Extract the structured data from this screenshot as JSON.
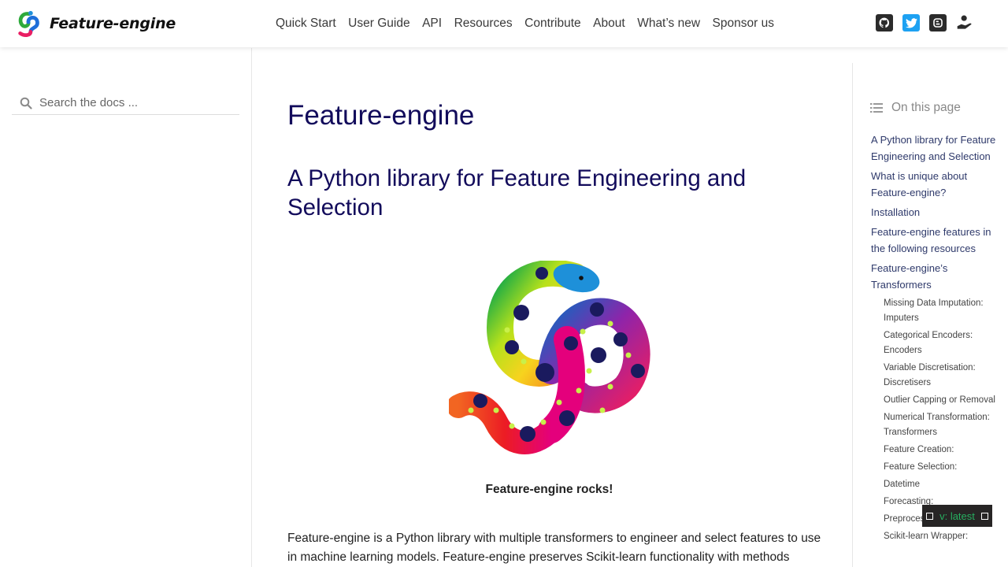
{
  "brand": {
    "name": "Feature-engine"
  },
  "nav": {
    "links": [
      "Quick Start",
      "User Guide",
      "API",
      "Resources",
      "Contribute",
      "About",
      "What’s new",
      "Sponsor us"
    ],
    "icons": [
      "github-icon",
      "twitter-icon",
      "blogger-icon",
      "sponsor-icon"
    ]
  },
  "search": {
    "placeholder": "Search the docs ..."
  },
  "main": {
    "title": "Feature-engine",
    "section_title": "A Python library for Feature Engineering and Selection",
    "caption": "Feature-engine rocks!",
    "body_text": "Feature-engine is a Python library with multiple transformers to engineer and select features to use in machine learning models. Feature-engine preserves Scikit-learn functionality with methods"
  },
  "toc": {
    "header": "On this page",
    "items": [
      {
        "label": "A Python library for Feature Engineering and Selection",
        "level": 1
      },
      {
        "label": "What is unique about Feature-engine?",
        "level": 1
      },
      {
        "label": "Installation",
        "level": 1
      },
      {
        "label": "Feature-engine features in the following resources",
        "level": 1
      },
      {
        "label": "Feature-engine’s Transformers",
        "level": 1
      },
      {
        "label": "Missing Data Imputation: Imputers",
        "level": 2
      },
      {
        "label": "Categorical Encoders: Encoders",
        "level": 2
      },
      {
        "label": "Variable Discretisation: Discretisers",
        "level": 2
      },
      {
        "label": "Outlier Capping or Removal",
        "level": 2
      },
      {
        "label": "Numerical Transformation: Transformers",
        "level": 2
      },
      {
        "label": "Feature Creation:",
        "level": 2
      },
      {
        "label": "Feature Selection:",
        "level": 2
      },
      {
        "label": "Datetime",
        "level": 2
      },
      {
        "label": "Forecasting:",
        "level": 2
      },
      {
        "label": "Preprocessing:",
        "level": 2
      },
      {
        "label": "Scikit-learn Wrapper:",
        "level": 2
      }
    ]
  },
  "version": {
    "label": "v: latest",
    "color": "#27ae60"
  },
  "colors": {
    "heading": "#120b5b",
    "toc_link": "#2f3a6b"
  }
}
